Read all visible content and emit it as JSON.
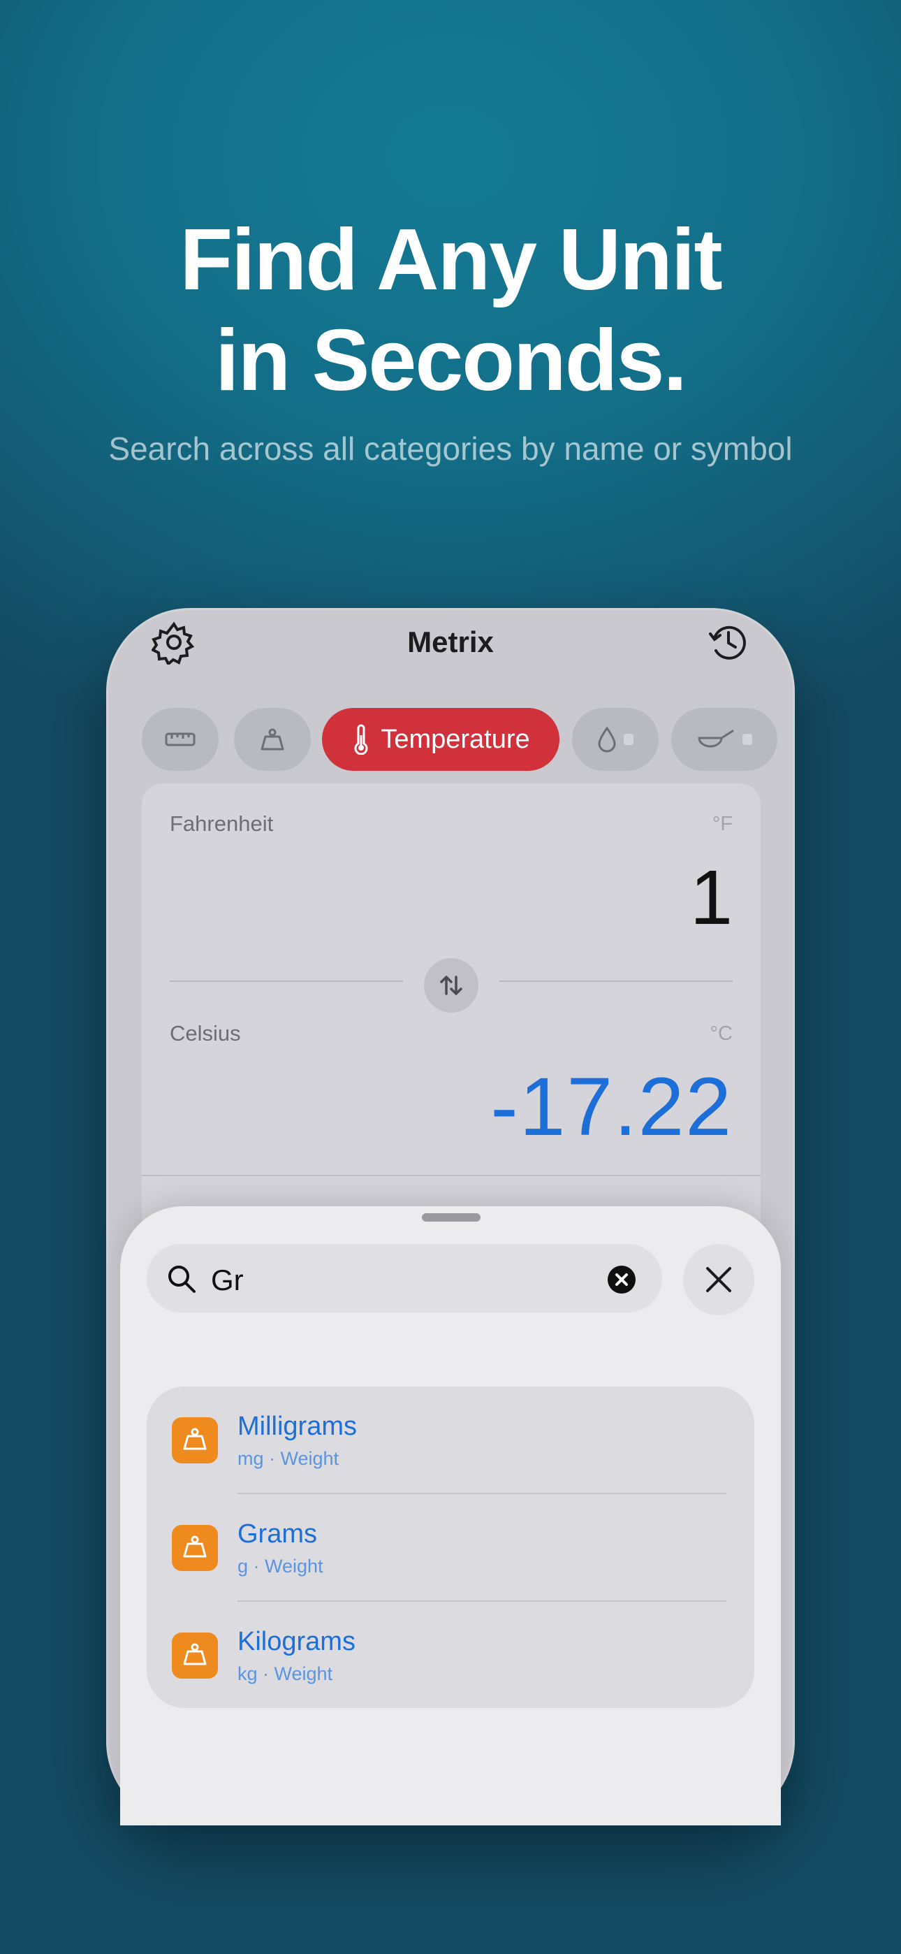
{
  "marketing": {
    "headline_line1": "Find Any Unit",
    "headline_line2": "in Seconds.",
    "subtitle": "Search across all categories by name or symbol"
  },
  "app": {
    "title": "Metrix",
    "categories": [
      {
        "icon": "ruler-icon",
        "label": ""
      },
      {
        "icon": "weight-icon",
        "label": ""
      },
      {
        "icon": "thermometer-icon",
        "label": "Temperature",
        "active": true
      },
      {
        "icon": "drop-icon",
        "label": "",
        "locked": true
      },
      {
        "icon": "pan-icon",
        "label": "",
        "locked": true
      }
    ],
    "accent_color": "#d0313a",
    "converter": {
      "from_unit": "Fahrenheit",
      "from_symbol": "°F",
      "from_value": "1",
      "to_unit": "Celsius",
      "to_symbol": "°C",
      "to_value": "-17.22",
      "result_color": "#1c6ed9"
    }
  },
  "search_sheet": {
    "query": "Gr",
    "results": [
      {
        "name": "Milligrams",
        "detail": "mg · Weight",
        "icon": "weight-icon"
      },
      {
        "name": "Grams",
        "detail": "g · Weight",
        "icon": "weight-icon"
      },
      {
        "name": "Kilograms",
        "detail": "kg · Weight",
        "icon": "weight-icon"
      }
    ],
    "result_icon_color": "#ef8a1f"
  }
}
